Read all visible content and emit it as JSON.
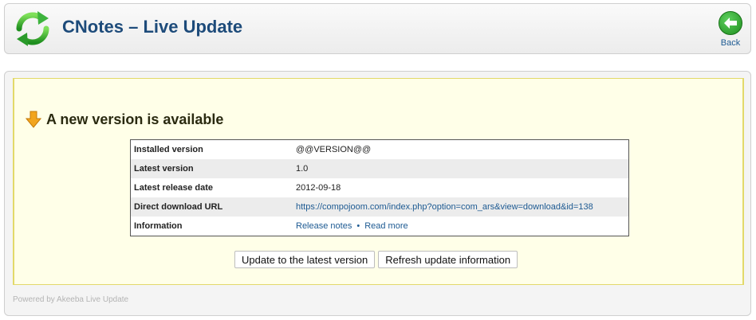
{
  "header": {
    "title": "CNotes – Live Update",
    "logo_icon": "refresh-arrows-icon",
    "back_label": "Back",
    "back_icon": "back-arrow-icon"
  },
  "notice": {
    "icon": "download-arrow-icon",
    "title": "A new version is available",
    "rows": [
      {
        "label": "Installed version",
        "value": "@@VERSION@@"
      },
      {
        "label": "Latest version",
        "value": "1.0"
      },
      {
        "label": "Latest release date",
        "value": "2012-09-18"
      },
      {
        "label": "Direct download URL",
        "value": "https://compojoom.com/index.php?option=com_ars&view=download&id=138"
      },
      {
        "label": "Information",
        "links": [
          "Release notes",
          "Read more"
        ],
        "separator": "•"
      }
    ]
  },
  "buttons": {
    "update": "Update to the latest version",
    "refresh": "Refresh update information"
  },
  "footer": "Powered by Akeeba Live Update",
  "colors": {
    "title": "#1d4b7a",
    "link": "#1d5a92",
    "notice_bg": "#ffffe8",
    "notice_border": "#e2d96a",
    "back_green": "#1e8d1e"
  }
}
